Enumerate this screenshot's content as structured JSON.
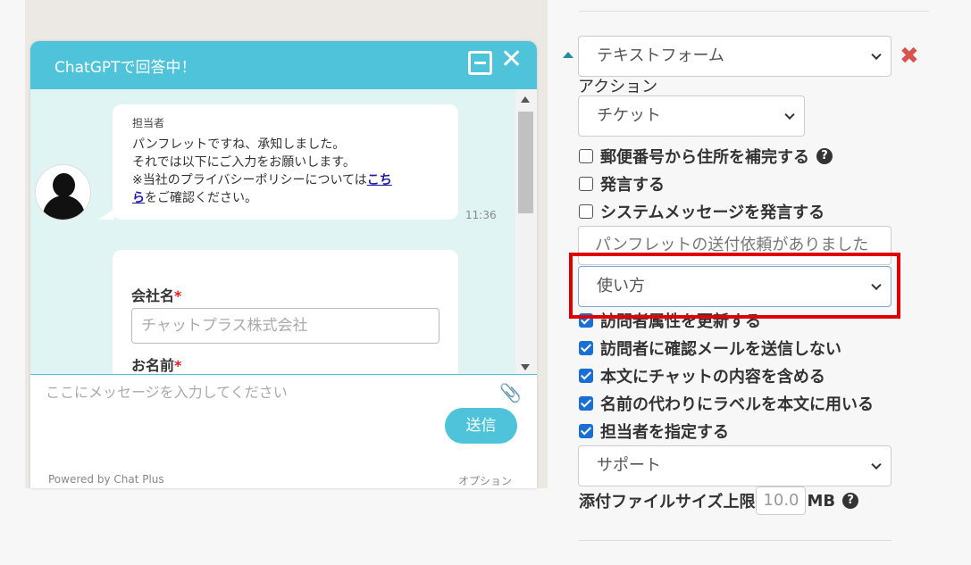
{
  "chat_widget": {
    "title": "ChatGPTで回答中！",
    "sender": "担当者",
    "message_lines": [
      "パンフレットですね、承知しました。",
      "それでは以下にご入力をお願いします。"
    ],
    "privacy_prefix": "※当社のプライバシーポリシーについては",
    "privacy_link_1": "こち",
    "privacy_link_2": "ら",
    "privacy_suffix": "をご確認ください。",
    "time": "11:36",
    "form": {
      "company_label": "会社名",
      "company_placeholder": "チャットプラス株式会社",
      "name_label": "お名前",
      "required_mark": "*"
    },
    "input_placeholder": "ここにメッセージを入力してください",
    "send_label": "送信",
    "powered_by": "Powered by Chat Plus",
    "option_label": "オプション"
  },
  "settings": {
    "type_select": "テキストフォーム",
    "action_label": "アクション",
    "action_select": "チケット",
    "checkboxes": [
      {
        "label": "郵便番号から住所を補完する",
        "checked": false,
        "help": true
      },
      {
        "label": "発言する",
        "checked": false
      },
      {
        "label": "システムメッセージを発言する",
        "checked": false
      }
    ],
    "message_input": "パンフレットの送付依頼がありました",
    "usage_select": "使い方",
    "checkboxes_checked": [
      {
        "label": "訪問者属性を更新する",
        "checked": true
      },
      {
        "label": "訪問者に確認メールを送信しない",
        "checked": true
      },
      {
        "label": "本文にチャットの内容を含める",
        "checked": true
      },
      {
        "label": "名前の代わりにラベルを本文に用いる",
        "checked": true
      },
      {
        "label": "担当者を指定する",
        "checked": true
      }
    ],
    "assignee_select": "サポート",
    "file_size_label": "添付ファイルサイズ上限",
    "file_size_value": "10.0",
    "file_size_unit": "MB"
  },
  "colors": {
    "chat_accent": "#4ec3da",
    "highlight": "#e00000",
    "checkbox": "#1a6fd4"
  }
}
